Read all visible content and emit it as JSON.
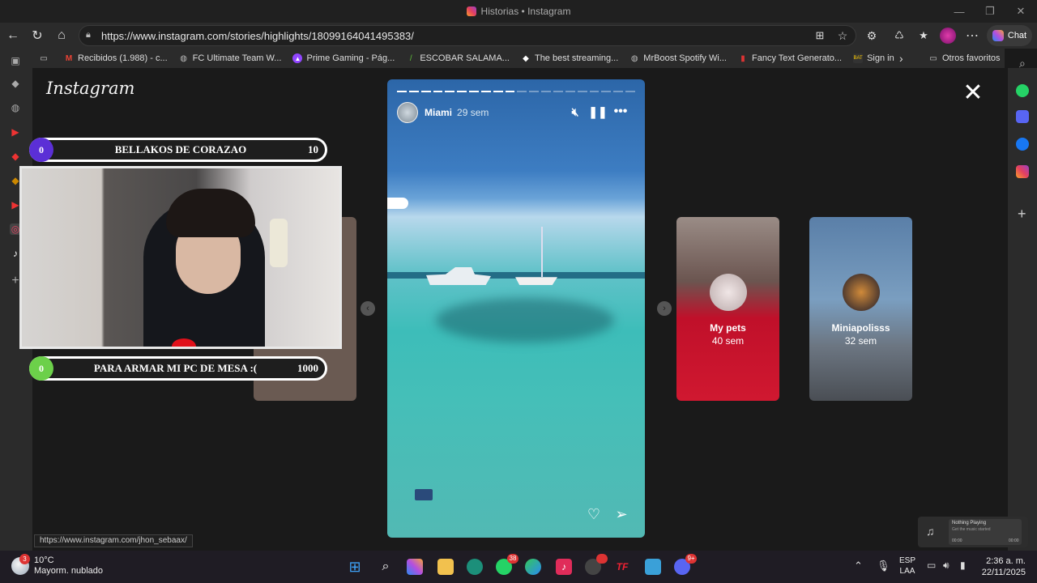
{
  "window": {
    "title": "Historias • Instagram"
  },
  "address_bar": {
    "url": "https://www.instagram.com/stories/highlights/18099164041495383/"
  },
  "browser": {
    "chat_label": "Chat"
  },
  "bookmarks": [
    {
      "label": "Recibidos (1.988) - c...",
      "icon": "gmail-icon",
      "color": "#ea4335"
    },
    {
      "label": "FC Ultimate Team W...",
      "icon": "globe-icon",
      "color": "#bbbbbb"
    },
    {
      "label": "Prime Gaming - Pág...",
      "icon": "prime-gaming-icon",
      "color": "#9146ff"
    },
    {
      "label": "ESCOBAR SALAMA...",
      "icon": "leaf-icon",
      "color": "#5fbf3a"
    },
    {
      "label": "The best streaming...",
      "icon": "diamond-icon",
      "color": "#ffffff"
    },
    {
      "label": "MrBoost Spotify Wi...",
      "icon": "globe-icon",
      "color": "#bbbbbb"
    },
    {
      "label": "Fancy Text Generato...",
      "icon": "bottle-icon",
      "color": "#d33"
    },
    {
      "label": "Sign in",
      "icon": "bat-icon",
      "color": "#333333"
    }
  ],
  "other_favorites": "Otros favoritos",
  "instagram": {
    "logo_text": "Instagram"
  },
  "story": {
    "username": "Miami",
    "time": "29 sem",
    "segments_total": 20,
    "segments_done": 10
  },
  "thumbnails": [
    {
      "name": "My pets",
      "time": "40 sem"
    },
    {
      "name": "Miniapolisss",
      "time": "32 sem"
    }
  ],
  "overlay": {
    "goal_top": {
      "left": "0",
      "label": "BELLAKOS DE CORAZAO",
      "right": "10",
      "color": "#5b2fd6"
    },
    "goal_bottom": {
      "left": "0",
      "label": "PARA ARMAR MI PC DE MESA :(",
      "right": "1000",
      "color": "#6cd04a"
    }
  },
  "status_link": "https://www.instagram.com/jhon_sebaax/",
  "music_widget": {
    "title": "Nothing Playing",
    "subtitle": "Get the music started",
    "time_left": "00:00",
    "time_right": "00:00"
  },
  "taskbar": {
    "weather_temp": "10°C",
    "weather_desc": "Mayorm. nublado",
    "weather_badge": "3",
    "whatsapp_badge": "38",
    "discord_badge": "9+",
    "lang_top": "ESP",
    "lang_bottom": "LAA",
    "time": "2:36 a. m.",
    "date": "22/11/2025"
  }
}
